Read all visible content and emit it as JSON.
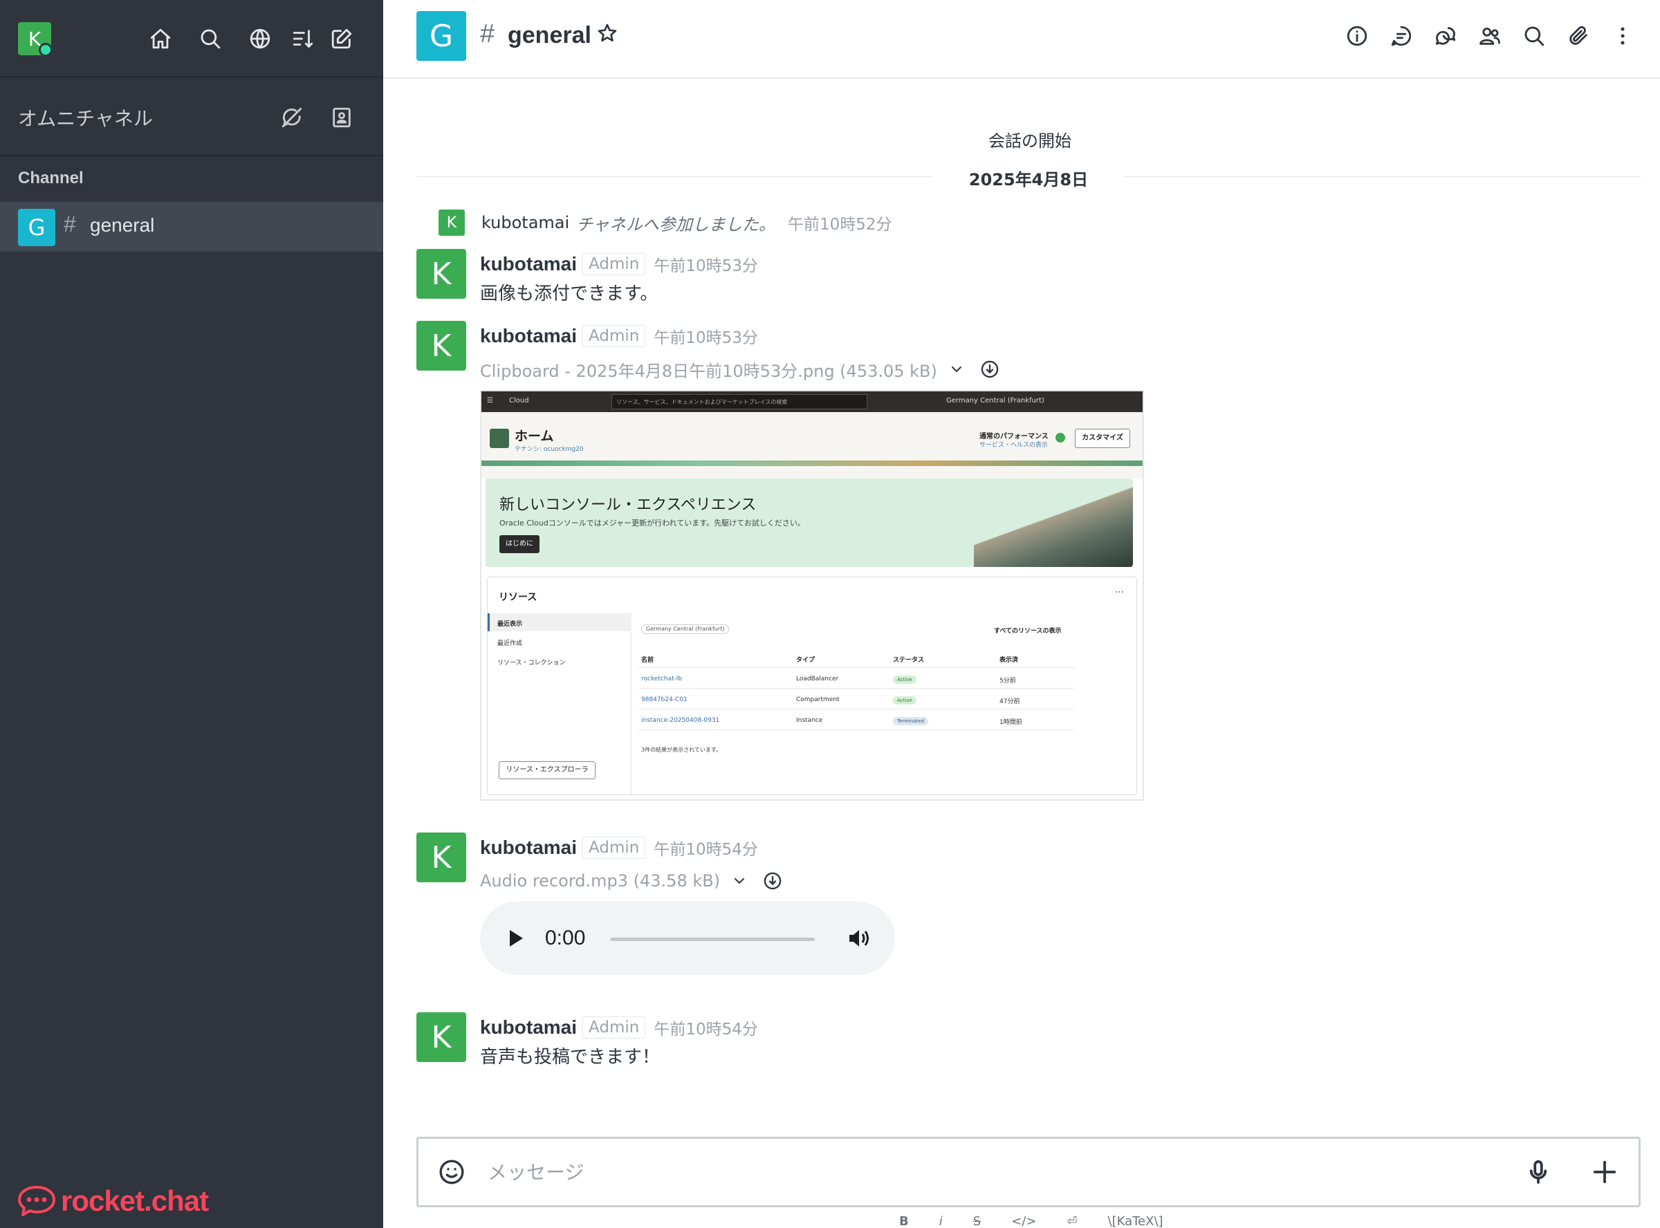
{
  "sidebar": {
    "user_initial": "K",
    "omnichannel_label": "オムニチャネル",
    "section_title": "Channel",
    "channels": [
      {
        "initial": "G",
        "hash": "#",
        "name": "general"
      }
    ],
    "brand_text": "rocket.chat"
  },
  "header": {
    "room_initial": "G",
    "room_hash": "#",
    "room_title": "general"
  },
  "conversation": {
    "start_label": "会話の開始",
    "date_label": "2025年4月8日",
    "system_message": {
      "initial": "K",
      "user": "kubotamai",
      "text": "チャネルへ参加しました。",
      "time": "午前10時52分"
    },
    "messages": [
      {
        "initial": "K",
        "user": "kubotamai",
        "role": "Admin",
        "time": "午前10時53分",
        "text": "画像も添付できます。"
      },
      {
        "initial": "K",
        "user": "kubotamai",
        "role": "Admin",
        "time": "午前10時53分",
        "attachment": "Clipboard - 2025年4月8日午前10時53分.png (453.05 kB)"
      },
      {
        "initial": "K",
        "user": "kubotamai",
        "role": "Admin",
        "time": "午前10時54分",
        "attachment": "Audio record.mp3 (43.58 kB)",
        "audio_time": "0:00"
      },
      {
        "initial": "K",
        "user": "kubotamai",
        "role": "Admin",
        "time": "午前10時54分",
        "text": "音声も投稿できます！"
      }
    ]
  },
  "screenshot": {
    "bar_cloud": "Cloud",
    "bar_search": "リソース、サービス、ドキュメントおよびマーケットプレイスの検索",
    "bar_region": "Germany Central (Frankfurt)",
    "home_title": "ホーム",
    "home_sub": "テナンシ: ocuockmg20",
    "perf_title": "通常のパフォーマンス",
    "perf_link": "サービス・ヘルスの表示",
    "customize": "カスタマイズ",
    "banner_title": "新しいコンソール・エクスペリエンス",
    "banner_text": "Oracle Cloudコンソールではメジャー更新が行われています。先駆けてお試しください。",
    "banner_button": "はじめに",
    "resources_title": "リソース",
    "side_items": [
      "最近表示",
      "最近作成",
      "リソース・コレクション"
    ],
    "region_tag": "Germany Central (Frankfurt)",
    "view_all": "すべてのリソースの表示",
    "columns": [
      "名前",
      "タイプ",
      "ステータス",
      "表示済"
    ],
    "rows": [
      {
        "name": "rocketchat-lb",
        "type": "LoadBalancer",
        "status": "Active",
        "viewed": "5分前"
      },
      {
        "name": "98847b24-C01",
        "type": "Compartment",
        "status": "Active",
        "viewed": "47分前"
      },
      {
        "name": "instance-20250408-0931",
        "type": "Instance",
        "status": "Terminated",
        "viewed": "1時間前"
      }
    ],
    "footer": "3件の結果が表示されています。",
    "explorer_button": "リソース・エクスプローラ"
  },
  "composer": {
    "placeholder": "メッセージ",
    "formatting": [
      "B",
      "i",
      "S",
      "</>",
      "⏎",
      "\\[KaTeX\\]"
    ]
  },
  "colors": {
    "sidebar_bg": "#2f343d",
    "room_avatar": "#19b6d0",
    "user_avatar": "#3cac52",
    "brand": "#f5455c",
    "status_online": "#2de0a5"
  }
}
